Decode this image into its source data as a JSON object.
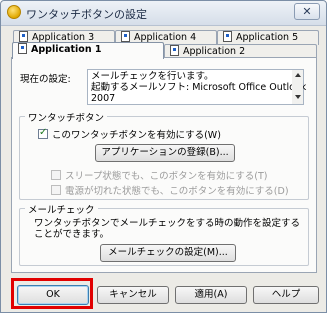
{
  "window": {
    "title": "ワンタッチボタンの設定",
    "close_glyph": "✕"
  },
  "tabs_back": [
    {
      "label": "Application 3"
    },
    {
      "label": "Application 4"
    },
    {
      "label": "Application 5"
    }
  ],
  "tabs_front": [
    {
      "label": "Application 1",
      "active": true
    },
    {
      "label": "Application 2",
      "active": false
    }
  ],
  "current_setting": {
    "label": "現在の設定:",
    "lines": [
      "メールチェックを行います。",
      "起動するメールソフト: Microsoft Office Outlook",
      "2007"
    ]
  },
  "onetouch_group": {
    "title": "ワンタッチボタン",
    "enable_checkbox": {
      "label": "このワンタッチボタンを有効にする(W)",
      "checked": true
    },
    "register_button": "アプリケーションの登録(B)...",
    "sleep_checkbox": {
      "label": "スリープ状態でも、このボタンを有効にする(T)",
      "checked": false,
      "disabled": true
    },
    "poweroff_checkbox": {
      "label": "電源が切れた状態でも、このボタンを有効にする(D)",
      "checked": false,
      "disabled": true
    }
  },
  "mailcheck_group": {
    "title": "メールチェック",
    "description_lines": [
      "ワンタッチボタンでメールチェックをする時の動作を設定する",
      "ことができます。"
    ],
    "settings_button": "メールチェックの設定(M)..."
  },
  "footer": {
    "ok": "OK",
    "cancel": "キャンセル",
    "apply": "適用(A)",
    "help": "ヘルプ"
  },
  "colors": {
    "highlight": "#e10000"
  }
}
